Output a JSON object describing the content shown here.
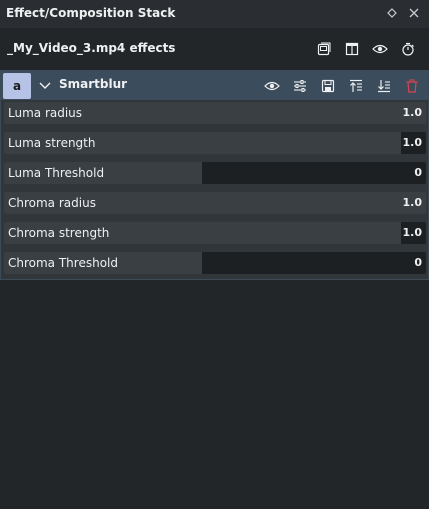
{
  "window": {
    "title": "Effect/Composition Stack",
    "float_icon": "float-diamond-icon",
    "close_icon": "close-icon"
  },
  "header": {
    "clip_label": "_My_Video_3.mp4 effects",
    "icons": [
      "save-stack-icon",
      "split-compare-icon",
      "eye-icon",
      "timer-icon"
    ]
  },
  "effect": {
    "badge": "a",
    "name": "Smartblur",
    "icons": [
      "eye-icon",
      "adjust-icon",
      "save-icon",
      "move-up-icon",
      "move-down-icon",
      "delete-icon"
    ],
    "accent": "#b6c2e6",
    "delete_color": "#da4453",
    "params": [
      {
        "label": "Luma radius",
        "value": "1.0",
        "level": 1.0
      },
      {
        "label": "Luma strength",
        "value": "1.0",
        "level": 0.94
      },
      {
        "label": "Luma Threshold",
        "value": "0",
        "level": 0.47
      },
      {
        "label": "Chroma radius",
        "value": "1.0",
        "level": 1.0
      },
      {
        "label": "Chroma strength",
        "value": "1.0",
        "level": 0.94
      },
      {
        "label": "Chroma Threshold",
        "value": "0",
        "level": 0.47
      }
    ]
  }
}
